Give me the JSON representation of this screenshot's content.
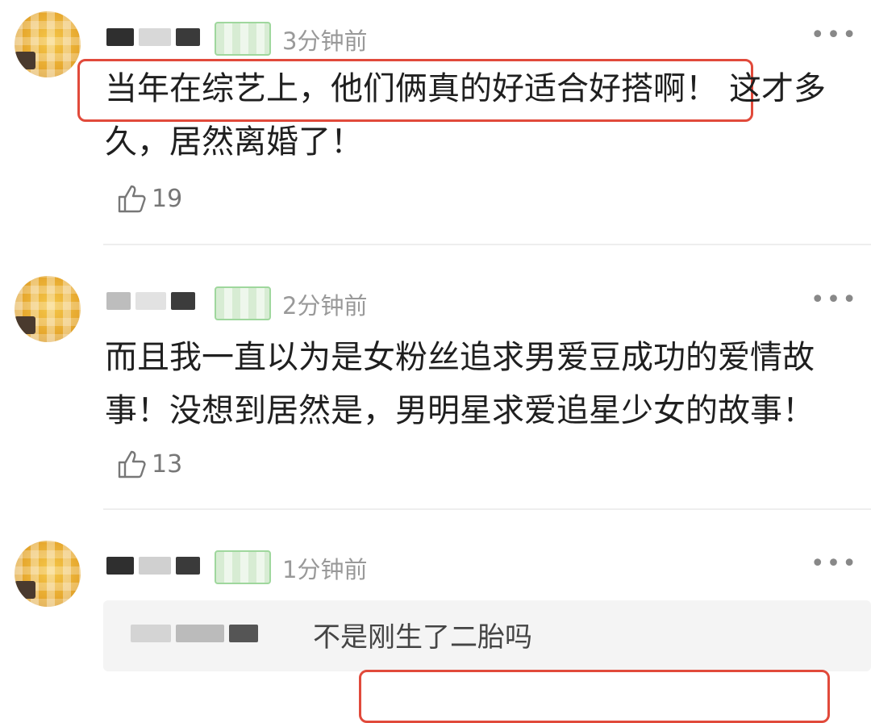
{
  "comments": [
    {
      "time": "3分钟前",
      "more": "•••",
      "text": "当年在综艺上，他们俩真的好适合好搭啊！这才多久，居然离婚了！",
      "highlight": "当年在综艺上，他们俩真的好适合好搭啊！",
      "rest_line1": "这才多",
      "line2": "久，居然离婚了！",
      "likes": "19"
    },
    {
      "time": "2分钟前",
      "more": "•••",
      "line1": "而且我一直以为是女粉丝追求男爱豆成功的爱情故",
      "line2": "事！没想到居然是，男明星求爱追星少女的故事！",
      "likes": "13"
    },
    {
      "time": "1分钟前",
      "more": "•••",
      "reply_text": "不是刚生了二胎吗"
    }
  ],
  "colors": {
    "highlight_border": "#e14a3b",
    "time_gray": "#999999",
    "badge_green": "#9fd79d"
  }
}
